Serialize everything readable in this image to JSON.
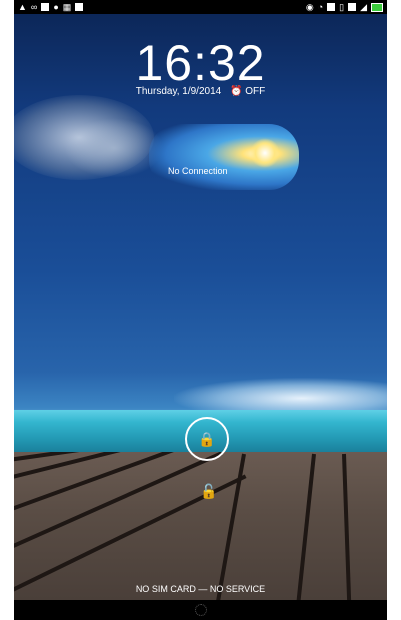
{
  "status_bar": {
    "left_icons": [
      "warning-icon",
      "voicemail-icon",
      "calendar-icon",
      "location-icon",
      "apps-icon",
      "document-icon"
    ],
    "right_icons": [
      "sync-icon",
      "wifi-icon",
      "screenshot-icon",
      "no-signal-icon",
      "screenshot-icon",
      "signal-icon",
      "battery-icon"
    ],
    "battery_color": "#3ccc3c"
  },
  "lock_screen": {
    "time": "16:32",
    "date": "Thursday, 1/9/2014",
    "alarm_label": "OFF",
    "weather_text": "No Connection",
    "carrier_text": "NO SIM CARD — NO SERVICE"
  }
}
